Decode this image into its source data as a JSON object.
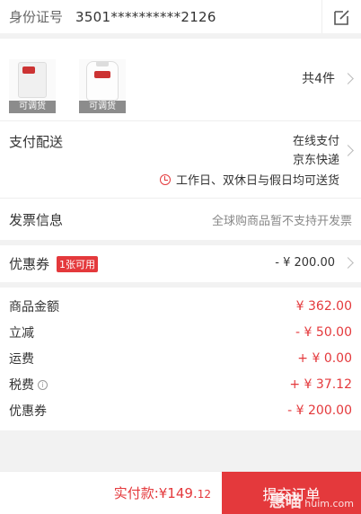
{
  "identity": {
    "label": "身份证号",
    "value": "3501**********2126"
  },
  "products": {
    "items": [
      {
        "tag": "可调货"
      },
      {
        "tag": "可调货"
      }
    ],
    "count_label": "共4件"
  },
  "delivery": {
    "label": "支付配送",
    "payment": "在线支付",
    "carrier": "京东快递",
    "notice": "工作日、双休日与假日均可送货"
  },
  "invoice": {
    "label": "发票信息",
    "note": "全球购商品暂不支持开发票"
  },
  "coupon": {
    "label": "优惠券",
    "badge": "1张可用",
    "value": "- ¥ 200.00"
  },
  "summary": [
    {
      "label": "商品金额",
      "value": "¥ 362.00",
      "info": false
    },
    {
      "label": "立减",
      "value": "- ¥ 50.00",
      "info": false
    },
    {
      "label": "运费",
      "value": "+ ¥ 0.00",
      "info": false
    },
    {
      "label": "税费",
      "value": "+ ¥ 37.12",
      "info": true
    },
    {
      "label": "优惠券",
      "value": "- ¥ 200.00",
      "info": false
    }
  ],
  "footer": {
    "pay_label": "实付款:",
    "pay_amount": "¥149.",
    "pay_cents": "12",
    "submit_label": "提交订单",
    "watermark_big": "惠喵",
    "watermark_small": "huim.com"
  },
  "colors": {
    "accent": "#e4393c",
    "background": "#f2f2f2"
  }
}
